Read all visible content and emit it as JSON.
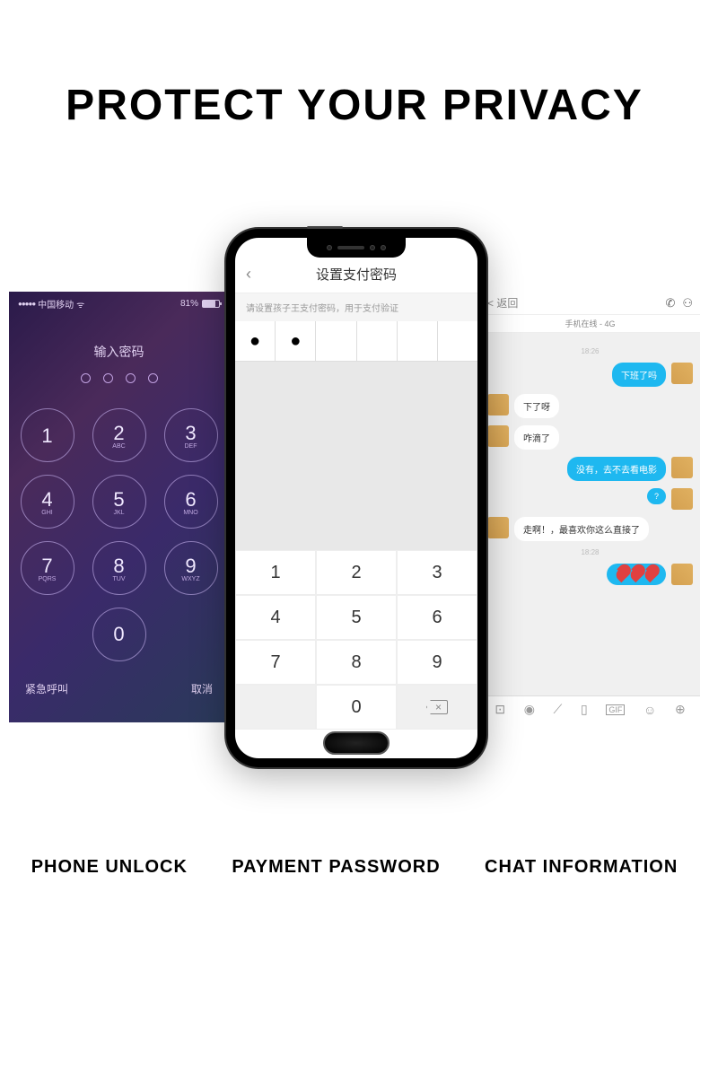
{
  "main_title": "PROTECT YOUR PRIVACY",
  "labels": {
    "left": "PHONE UNLOCK",
    "center": "PAYMENT PASSWORD",
    "right": "CHAT INFORMATION"
  },
  "lock_screen": {
    "carrier": "中国移动",
    "battery_pct": "81%",
    "title": "输入密码",
    "emergency": "紧急呼叫",
    "cancel": "取消",
    "keys": [
      {
        "num": "1",
        "letters": ""
      },
      {
        "num": "2",
        "letters": "ABC"
      },
      {
        "num": "3",
        "letters": "DEF"
      },
      {
        "num": "4",
        "letters": "GHI"
      },
      {
        "num": "5",
        "letters": "JKL"
      },
      {
        "num": "6",
        "letters": "MNO"
      },
      {
        "num": "7",
        "letters": "PQRS"
      },
      {
        "num": "8",
        "letters": "TUV"
      },
      {
        "num": "9",
        "letters": "WXYZ"
      },
      {
        "num": "0",
        "letters": ""
      }
    ]
  },
  "payment": {
    "title": "设置支付密码",
    "subtitle": "请设置孩子王支付密码，用于支付验证",
    "entered_count": 2,
    "numpad": [
      "1",
      "2",
      "3",
      "4",
      "5",
      "6",
      "7",
      "8",
      "9",
      "",
      "0",
      "del"
    ]
  },
  "chat": {
    "back": "< 返回",
    "sub_header": "手机在线 - 4G",
    "time1": "18:26",
    "time2": "18:28",
    "messages": [
      {
        "dir": "out",
        "text": "下班了吗"
      },
      {
        "dir": "in",
        "text": "下了呀"
      },
      {
        "dir": "in",
        "text": "咋滴了"
      },
      {
        "dir": "out",
        "text": "没有，去不去看电影"
      },
      {
        "dir": "out",
        "text": "?"
      },
      {
        "dir": "in",
        "text": "走啊！，最喜欢你这么直接了"
      },
      {
        "dir": "out",
        "text": "hearts"
      }
    ]
  }
}
